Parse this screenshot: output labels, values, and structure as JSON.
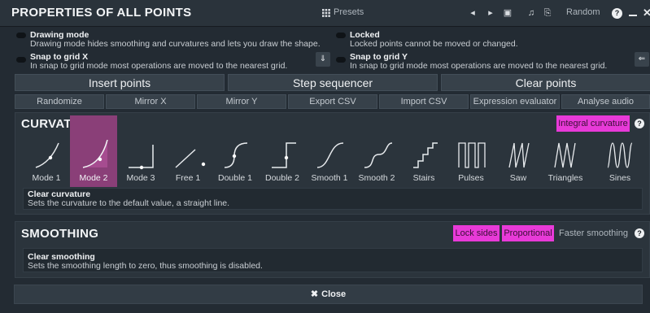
{
  "window": {
    "title": "PROPERTIES OF ALL POINTS",
    "presets_label": "Presets",
    "random_label": "Random"
  },
  "options": {
    "drawing_mode": {
      "title": "Drawing mode",
      "desc": "Drawing mode hides smoothing and curvatures and lets you draw the shape."
    },
    "locked": {
      "title": "Locked",
      "desc": "Locked points cannot be moved or changed."
    },
    "snap_x": {
      "title": "Snap to grid X",
      "desc": "In snap to grid mode most operations are moved to the nearest grid."
    },
    "snap_y": {
      "title": "Snap to grid Y",
      "desc": "In snap to grid mode most operations are moved to the nearest grid."
    }
  },
  "actions": {
    "insert": "Insert points",
    "step": "Step sequencer",
    "clear": "Clear points"
  },
  "tools": [
    "Randomize",
    "Mirror X",
    "Mirror Y",
    "Export CSV",
    "Import CSV",
    "Expression evaluator",
    "Analyse audio"
  ],
  "curvature": {
    "title": "CURVATURE",
    "integral": "Integral curvature",
    "modes": [
      "Mode 1",
      "Mode 2",
      "Mode 3",
      "Free 1",
      "Double 1",
      "Double 2",
      "Smooth 1",
      "Smooth 2",
      "Stairs",
      "Pulses",
      "Saw",
      "Triangles",
      "Sines"
    ],
    "selected": "Mode 2",
    "info_title": "Clear curvature",
    "info_desc": "Sets the curvature to the default value, a straight line."
  },
  "smoothing": {
    "title": "SMOOTHING",
    "lock_sides": "Lock sides",
    "proportional": "Proportional",
    "faster": "Faster smoothing",
    "info_title": "Clear smoothing",
    "info_desc": "Sets the smoothing length to zero, thus smoothing is disabled."
  },
  "close_label": "Close",
  "colors": {
    "accent": "#e83ad8",
    "selected_mode": "#8a3f78",
    "background": "#1c2228"
  }
}
